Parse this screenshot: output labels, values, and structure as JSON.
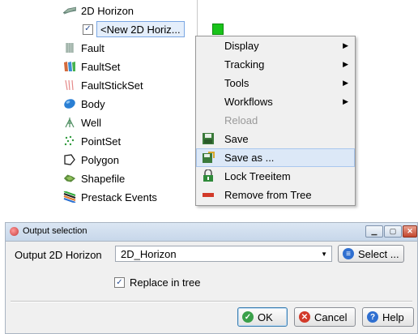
{
  "tree": {
    "items": [
      {
        "label": "2D Horizon",
        "icon": "horizon-2d-icon"
      },
      {
        "label": "Fault",
        "icon": "fault-icon"
      },
      {
        "label": "FaultSet",
        "icon": "faultset-icon"
      },
      {
        "label": "FaultStickSet",
        "icon": "faultstickset-icon"
      },
      {
        "label": "Body",
        "icon": "body-icon"
      },
      {
        "label": "Well",
        "icon": "well-icon"
      },
      {
        "label": "PointSet",
        "icon": "pointset-icon"
      },
      {
        "label": "Polygon",
        "icon": "polygon-icon"
      },
      {
        "label": "Shapefile",
        "icon": "shapefile-icon"
      },
      {
        "label": "Prestack Events",
        "icon": "prestack-events-icon"
      }
    ],
    "selected_child": {
      "label": "<New 2D Horiz...",
      "checked": true,
      "color": "#19c31a"
    }
  },
  "context_menu": {
    "items": [
      {
        "label": "Display",
        "submenu": true
      },
      {
        "label": "Tracking",
        "submenu": true
      },
      {
        "label": "Tools",
        "submenu": true
      },
      {
        "label": "Workflows",
        "submenu": true
      },
      {
        "label": "Reload",
        "disabled": true
      },
      {
        "label": "Save",
        "icon": "save-icon"
      },
      {
        "label": "Save as ...",
        "icon": "save-as-icon",
        "highlighted": true
      },
      {
        "label": "Lock Treeitem",
        "icon": "lock-icon"
      },
      {
        "label": "Remove from Tree",
        "icon": "remove-icon"
      }
    ]
  },
  "dialog": {
    "title": "Output selection",
    "output_label": "Output 2D Horizon",
    "output_value": "2D_Horizon",
    "select_label": "Select ...",
    "replace_label": "Replace in tree",
    "replace_checked": true,
    "ok_label": "OK",
    "cancel_label": "Cancel",
    "help_label": "Help"
  },
  "colors": {
    "highlight": "#dce8f7",
    "ok_icon": "#3aa04a",
    "cancel_icon": "#d23a2a",
    "help_icon": "#2f6fd0",
    "select_icon": "#2f6fd0"
  }
}
